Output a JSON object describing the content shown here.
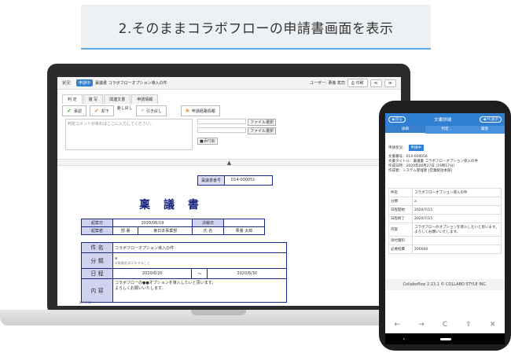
{
  "heading": "2.そのままコラボフローの申請書画面を表示",
  "laptop": {
    "topbar": {
      "status_label": "状況：",
      "status_badge": "申請中",
      "doc_name": "稟議書 コラボフローオプション導入の件",
      "user": "ユーザー: 栗養 篤司",
      "print_label": "印刷",
      "prev_label": "≪",
      "next_label": "≫"
    },
    "tabs": [
      "判 定",
      "複 写",
      "関連文書",
      "申請情報"
    ],
    "actions": {
      "approve": "承認",
      "reject": "却下",
      "sendback": "差し戻し",
      "withdraw": "引き戻し",
      "route": "申請経路情報"
    },
    "comment_placeholder": "判定コメントがあればここに入力してください。",
    "file_select": "ファイル選択",
    "file_delete": "■添付削",
    "collapse": "▲",
    "doc_number_label": "稟議書番号",
    "doc_number": "014-000051",
    "doc_title": "稟 議 書",
    "meta": {
      "start_label": "起案日",
      "start_value": "2020/06/19",
      "decide_label": "決裁日",
      "decide_value": "",
      "drafter_label": "起案者",
      "dept_label": "部 署",
      "dept_value": "東日本事業部",
      "name_label": "氏 名",
      "name_value": "栗養 太郎"
    },
    "form": {
      "subject_label": "件 名",
      "subject_value": "コラボフローオプション導入の件",
      "category_label": "分 類",
      "category_value": "a",
      "category_note": "※稟議前はCCをすること",
      "schedule_label": "日 程",
      "schedule_from": "2020/6/20",
      "schedule_tilde": "〜",
      "schedule_to": "2020/6/30",
      "content_label": "内 容",
      "content_line1": "コラボフローの●●オプションを導入したいと思います。",
      "content_line2": "よろしくお願いいたします。",
      "scroll_note": "まだひは"
    }
  },
  "phone": {
    "header": {
      "back": "◀ 戻る",
      "title": "文書詳細",
      "pc": "◀ PC表示"
    },
    "tabs": [
      "詳細",
      "判定",
      "履歴"
    ],
    "status_label": "申請状況：",
    "status_badge": "申請中",
    "info": [
      "文書番号：014-000056",
      "文書タイトル：稟議書 コラボフローオプション導入の件",
      "作成日時：2020年06月27日 (19時17分)",
      "作成者：システム管理者 (営業統括本部)"
    ],
    "rows": [
      {
        "label": "件名",
        "value": "コラボフローオプション導入の件"
      },
      {
        "label": "分類",
        "value": "a"
      },
      {
        "label": "日程開始",
        "value": "2020/7/15"
      },
      {
        "label": "日程終了",
        "value": "2020/7/15"
      },
      {
        "label": "内容",
        "value": "コラボフローのオプションを導入したいと思います。よろしくお願いいたします。"
      },
      {
        "label": "添付資料",
        "value": ""
      },
      {
        "label": "必要経費",
        "value": "200000"
      }
    ],
    "footer": "Collaboflow 2.13.1 © COLLABO STYLE INC.",
    "nav": [
      "←",
      "→",
      "C",
      "⇪",
      "✕"
    ],
    "sysbar_back": "‹"
  }
}
